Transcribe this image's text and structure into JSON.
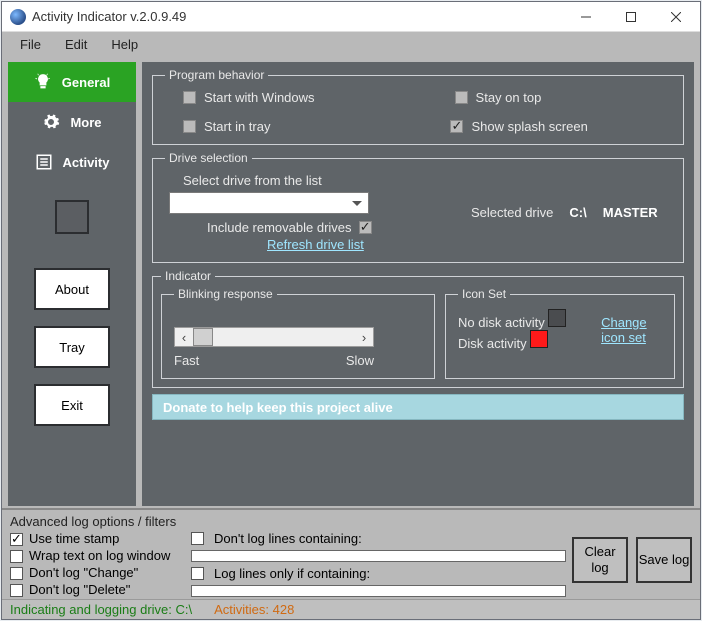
{
  "title": "Activity Indicator v.2.0.9.49",
  "menu": {
    "file": "File",
    "edit": "Edit",
    "help": "Help"
  },
  "sidebar": {
    "general": "General",
    "more": "More",
    "activity": "Activity",
    "about": "About",
    "tray": "Tray",
    "exit": "Exit"
  },
  "program_behavior": {
    "legend": "Program behavior",
    "start_with_windows": "Start with Windows",
    "start_in_tray": "Start in tray",
    "stay_on_top": "Stay on top",
    "show_splash": "Show splash screen",
    "checked": {
      "start_with_windows": false,
      "start_in_tray": false,
      "stay_on_top": false,
      "show_splash": true
    }
  },
  "drive_selection": {
    "legend": "Drive selection",
    "select_label": "Select drive from the list",
    "include_removable": "Include removable drives",
    "include_removable_checked": true,
    "refresh": "Refresh drive list",
    "selected_label": "Selected drive",
    "selected_drive": "C:\\",
    "selected_name": "MASTER"
  },
  "indicator": {
    "legend": "Indicator",
    "blinking_legend": "Blinking response",
    "fast": "Fast",
    "slow": "Slow",
    "iconset_legend": "Icon Set",
    "no_activity": "No disk activity",
    "activity": "Disk activity",
    "no_activity_color": "#4a4c4f",
    "activity_color": "#ff1a1a",
    "change_icon": "Change icon set"
  },
  "donate": "Donate to help keep this project alive",
  "advanced": {
    "title": "Advanced log options / filters",
    "use_timestamp": "Use time stamp",
    "use_timestamp_checked": true,
    "wrap_text": "Wrap text on log window",
    "dont_log_change": "Don't log \"Change\"",
    "dont_log_delete": "Don't log \"Delete\"",
    "dont_log_containing": "Don't log lines containing:",
    "only_if_containing": "Log lines only if containing:",
    "clear_log": "Clear log",
    "save_log": "Save log"
  },
  "status": {
    "indicating": "Indicating and logging  drive: C:\\",
    "activities_label": "Activities:",
    "activities_count": "428"
  }
}
